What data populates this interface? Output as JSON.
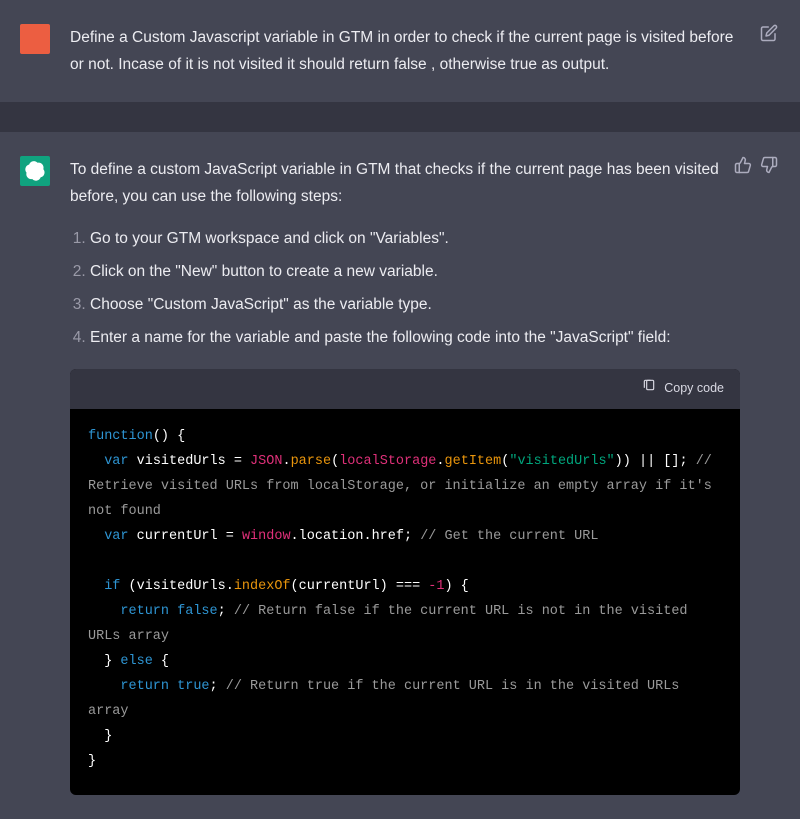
{
  "user": {
    "prompt": "Define a Custom Javascript variable in GTM in order to check if the current page is visited before or not. Incase of it is not visited it should return false , otherwise true as output."
  },
  "assistant": {
    "intro": "To define a custom JavaScript variable in GTM that checks if the current page has been visited before, you can use the following steps:",
    "steps": [
      "Go to your GTM workspace and click on \"Variables\".",
      "Click on the \"New\" button to create a new variable.",
      "Choose \"Custom JavaScript\" as the variable type.",
      "Enter a name for the variable and paste the following code into the \"JavaScript\" field:"
    ]
  },
  "codeblock": {
    "copy_label": "Copy code",
    "tokens": {
      "kw_function": "function",
      "paren_open_close_brace": "() {",
      "kw_var1": "var",
      "var_visitedUrls": " visitedUrls = ",
      "obj_json": "JSON",
      "dot1": ".",
      "fn_parse": "parse",
      "po1": "(",
      "obj_localStorage": "localStorage",
      "dot2": ".",
      "fn_getItem": "getItem",
      "po2": "(",
      "str_visitedUrls": "\"visitedUrls\"",
      "pc2": ")) || []; ",
      "comment1": "// Retrieve visited URLs from localStorage, or initialize an empty array if it's not found",
      "kw_var2": "var",
      "var_currentUrl": " currentUrl = ",
      "obj_window": "window",
      "dot3": ".",
      "prop_location": "location",
      "dot4": ".",
      "prop_href": "href",
      "semi1": "; ",
      "comment2": "// Get the current URL",
      "kw_if": "if",
      "if_open": " (visitedUrls.",
      "fn_indexOf": "indexOf",
      "if_mid": "(currentUrl) === ",
      "num_neg1": "-1",
      "if_close": ") {",
      "kw_return1": "return",
      "sp1": " ",
      "bool_false": "false",
      "semi2": "; ",
      "comment3": "// Return false if the current URL is not in the visited URLs array",
      "brace_close_else": "  } ",
      "kw_else": "else",
      "brace_open2": " {",
      "kw_return2": "return",
      "sp2": " ",
      "bool_true": "true",
      "semi3": "; ",
      "comment4": "// Return true if the current URL is in the visited URLs array",
      "brace_close_inner": "  }",
      "brace_close_outer": "}"
    }
  }
}
